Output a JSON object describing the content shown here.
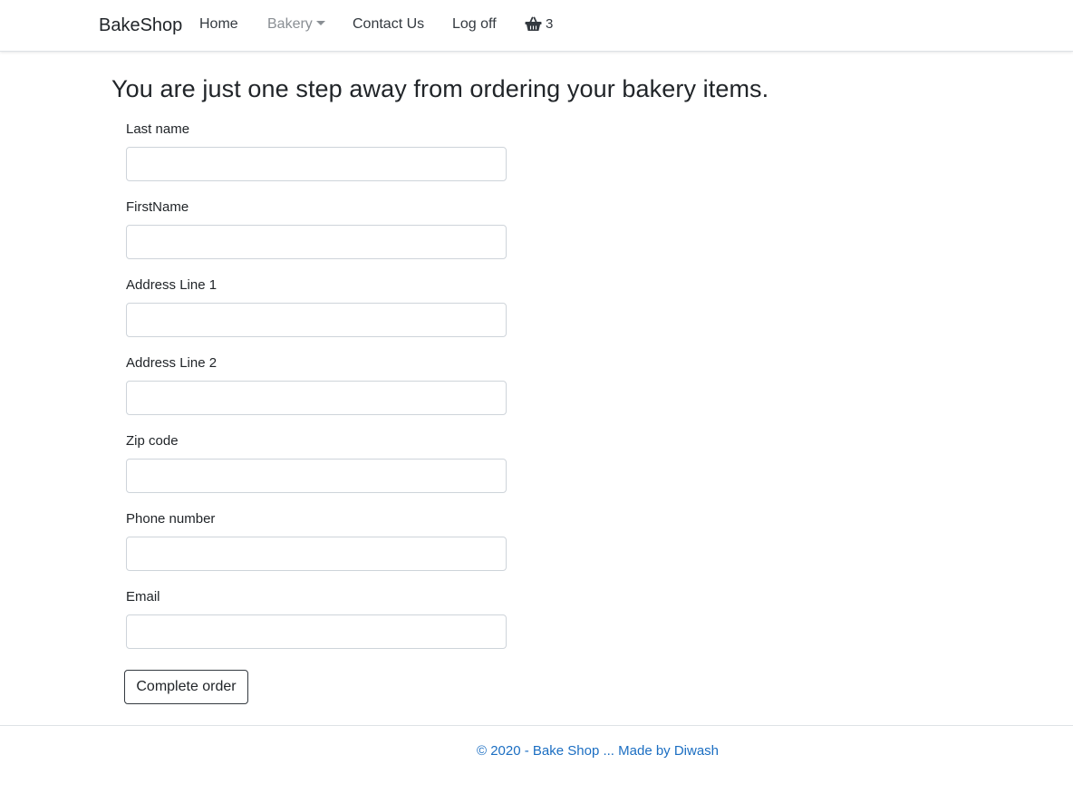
{
  "nav": {
    "brand": "BakeShop",
    "items": [
      {
        "label": "Home"
      },
      {
        "label": "Bakery"
      },
      {
        "label": "Contact Us"
      },
      {
        "label": "Log off"
      }
    ],
    "cart_count": "3",
    "cart_icon": "basket-icon"
  },
  "main": {
    "heading": "You are just one step away from ordering your bakery items.",
    "fields": [
      {
        "label": "Last name",
        "value": "",
        "placeholder": ""
      },
      {
        "label": "FirstName",
        "value": "",
        "placeholder": ""
      },
      {
        "label": "Address Line 1",
        "value": "",
        "placeholder": ""
      },
      {
        "label": "Address Line 2",
        "value": "",
        "placeholder": ""
      },
      {
        "label": "Zip code",
        "value": "",
        "placeholder": ""
      },
      {
        "label": "Phone number",
        "value": "",
        "placeholder": ""
      },
      {
        "label": "Email",
        "value": "",
        "placeholder": ""
      }
    ],
    "submit_label": "Complete order"
  },
  "footer": {
    "text": "© 2020 - Bake Shop ... Made by Diwash"
  },
  "colors": {
    "link": "#1b6ec2",
    "muted_nav": "#8a8f94",
    "border": "#ced4da"
  }
}
